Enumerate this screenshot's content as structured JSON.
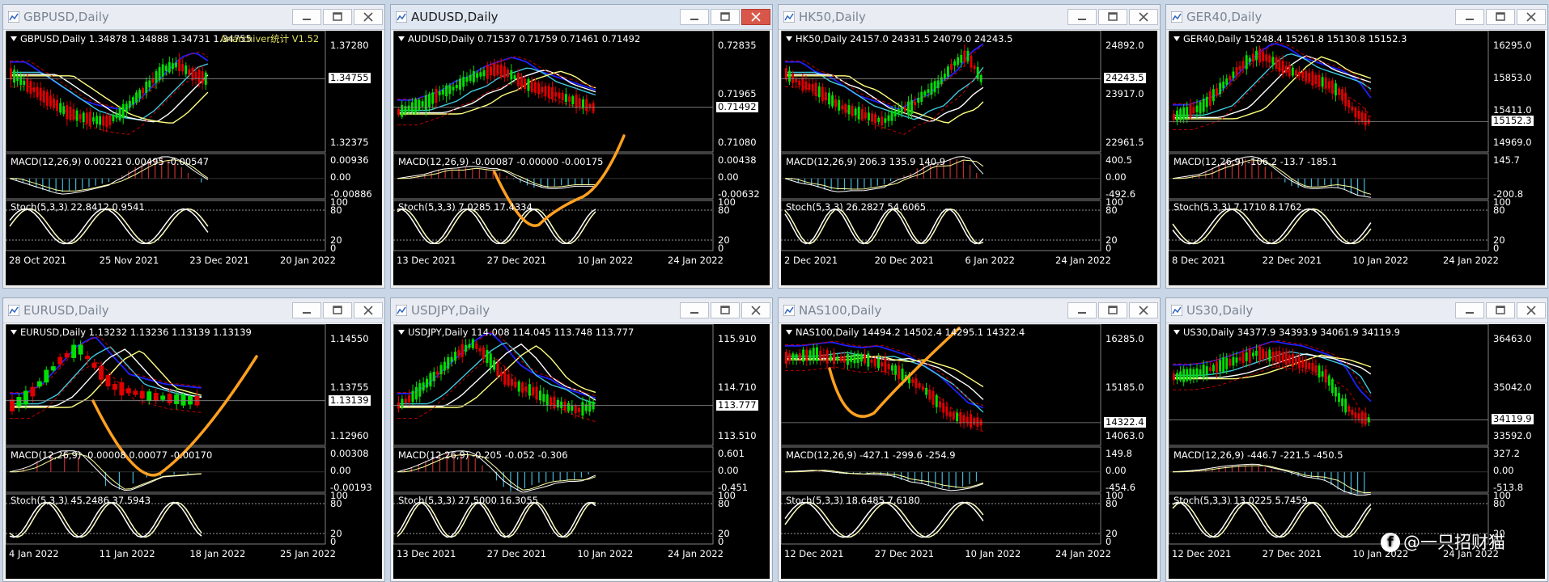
{
  "colors": {
    "background": "#000000",
    "bull": "#00e000",
    "bear": "#e00000",
    "ma_blue": "#2020ff",
    "ma_cyan": "#40c8e0",
    "ma_white": "#ffffff",
    "ma_yellow": "#ffff80",
    "envelope": "#c00000",
    "stoch": "#ffffc0",
    "annotation": "#ffa020"
  },
  "watermark": {
    "icon": "facebook-icon",
    "text": "@一只招财猫"
  },
  "windows": [
    {
      "title": "GBPUSD,Daily",
      "legend": "GBPUSD,Daily  1.34878 1.34888 1.34731 1.34755",
      "overlay_text": "Anarchiver统计 V1.52",
      "macd": "MACD(12,26,9) 0.00221 0.00495 -0.00547",
      "stoch": "Stoch(5,3,3) 22.8412 0.9541",
      "price_labels": [
        "1.37280",
        "1.32375"
      ],
      "price_box": "1.34755",
      "macd_labels": [
        "0.00936",
        "0.00",
        "-0.00886"
      ],
      "stoch_labels": [
        "100",
        "80",
        "20",
        "0"
      ],
      "date_labels": [
        "28 Oct 2021",
        "25 Nov 2021",
        "23 Dec 2021",
        "20 Jan 2022"
      ],
      "active": false
    },
    {
      "title": "AUDUSD,Daily",
      "legend": "AUDUSD,Daily  0.71537 0.71759 0.71461 0.71492",
      "macd": "MACD(12,26,9) -0.00087 -0.00000 -0.00175",
      "stoch": "Stoch(5,3,3) 7.0285 17.4334",
      "price_labels": [
        "0.72835",
        "0.71965",
        "0.71080"
      ],
      "price_box": "0.71492",
      "macd_labels": [
        "0.00438",
        "0.00",
        "-0.00632"
      ],
      "stoch_labels": [
        "100",
        "80",
        "20",
        "0"
      ],
      "date_labels": [
        "13 Dec 2021",
        "27 Dec 2021",
        "10 Jan 2022",
        "24 Jan 2022"
      ],
      "active": true
    },
    {
      "title": "HK50,Daily",
      "legend": "HK50,Daily  24157.0 24331.5 24079.0 24243.5",
      "macd": "MACD(12,26,9) 206.3 135.9 140.9",
      "stoch": "Stoch(5,3,3) 26.2827 54.6065",
      "price_labels": [
        "24892.0",
        "23917.0",
        "22961.5"
      ],
      "price_box": "24243.5",
      "macd_labels": [
        "400.5",
        "0.00",
        "-492.6"
      ],
      "stoch_labels": [
        "100",
        "80",
        "20",
        "0"
      ],
      "date_labels": [
        "2 Dec 2021",
        "20 Dec 2021",
        "6 Jan 2022",
        "24 Jan 2022"
      ],
      "active": false
    },
    {
      "title": "GER40,Daily",
      "legend": "GER40,Daily  15248.4 15261.8 15130.8 15152.3",
      "macd": "MACD(12,26,9) -106.2 -13.7 -185.1",
      "stoch": "Stoch(5,3,3) 7.1710 8.1762",
      "price_labels": [
        "16295.0",
        "15853.0",
        "15411.0",
        "14969.0"
      ],
      "price_box": "15152.3",
      "macd_labels": [
        "145.7",
        "-200.8"
      ],
      "stoch_labels": [
        "100",
        "80",
        "20",
        "0"
      ],
      "date_labels": [
        "8 Dec 2021",
        "22 Dec 2021",
        "10 Jan 2022",
        "24 Jan 2022"
      ],
      "active": false
    },
    {
      "title": "EURUSD,Daily",
      "legend": "EURUSD,Daily  1.13232 1.13236 1.13139 1.13139",
      "macd": "MACD(12,26,9) -0.00008 0.00077 -0.00170",
      "stoch": "Stoch(5,3,3) 45.2486 37.5943",
      "price_labels": [
        "1.14550",
        "1.13755",
        "1.12960"
      ],
      "price_box": "1.13139",
      "macd_labels": [
        "0.00308",
        "0.00",
        "-0.00193"
      ],
      "stoch_labels": [
        "100",
        "80",
        "20",
        "0"
      ],
      "date_labels": [
        "4 Jan 2022",
        "11 Jan 2022",
        "18 Jan 2022",
        "25 Jan 2022"
      ],
      "active": false
    },
    {
      "title": "USDJPY,Daily",
      "legend": "USDJPY,Daily  114.008 114.045 113.748 113.777",
      "macd": "MACD(12,26,9) -0.205 -0.052 -0.306",
      "stoch": "Stoch(5,3,3) 27.5000 16.3055",
      "price_labels": [
        "115.910",
        "114.710",
        "113.510"
      ],
      "price_box": "113.777",
      "macd_labels": [
        "0.601",
        "0.00",
        "-0.451"
      ],
      "stoch_labels": [
        "100",
        "80",
        "20",
        "0"
      ],
      "date_labels": [
        "13 Dec 2021",
        "27 Dec 2021",
        "10 Jan 2022",
        "24 Jan 2022"
      ],
      "active": false
    },
    {
      "title": "NAS100,Daily",
      "legend": "NAS100,Daily  14494.2 14502.4 14295.1 14322.4",
      "macd": "MACD(12,26,9) -427.1 -299.6 -254.9",
      "stoch": "Stoch(5,3,3) 18.6485 7.6180",
      "price_labels": [
        "16285.0",
        "15185.0",
        "14063.0"
      ],
      "price_box": "14322.4",
      "macd_labels": [
        "149.8",
        "0.00",
        "-454.6"
      ],
      "stoch_labels": [
        "100",
        "80",
        "20",
        "0"
      ],
      "date_labels": [
        "12 Dec 2021",
        "27 Dec 2021",
        "10 Jan 2022",
        "24 Jan 2022"
      ],
      "active": false
    },
    {
      "title": "US30,Daily",
      "legend": "US30,Daily  34377.9 34393.9 34061.9 34119.9",
      "macd": "MACD(12,26,9) -446.7 -221.5 -450.5",
      "stoch": "Stoch(5,3,3) 13.0225 5.7459",
      "price_labels": [
        "36463.0",
        "35042.0",
        "33592.0"
      ],
      "price_box": "34119.9",
      "macd_labels": [
        "327.2",
        "0.00",
        "-513.8"
      ],
      "stoch_labels": [
        "100",
        "80",
        "20",
        "0"
      ],
      "date_labels": [
        "12 Dec 2021",
        "27 Dec 2021",
        "10 Jan 2022",
        "24 Jan 2022"
      ],
      "active": false
    }
  ]
}
